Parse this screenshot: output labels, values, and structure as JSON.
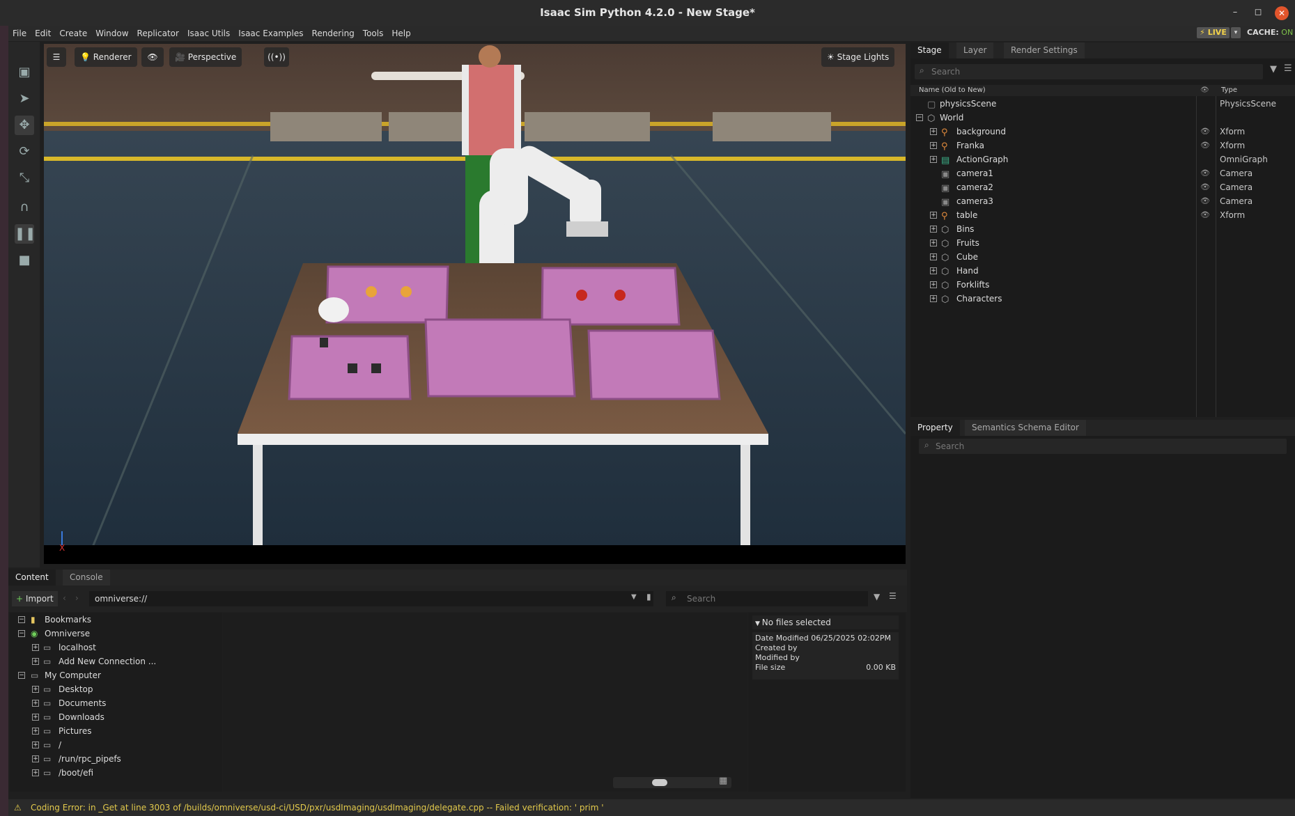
{
  "window": {
    "title": "Isaac Sim Python 4.2.0 - New Stage*",
    "minimize": "–",
    "restore": "◻",
    "close": "✕"
  },
  "menu": [
    "File",
    "Edit",
    "Create",
    "Window",
    "Replicator",
    "Isaac Utils",
    "Isaac Examples",
    "Rendering",
    "Tools",
    "Help"
  ],
  "live": {
    "label": "⚡ LIVE",
    "dropdown": "▾",
    "cache_label": "CACHE:",
    "cache_state": "ON"
  },
  "viewport_bar": {
    "renderer": "Renderer",
    "camera": "Perspective",
    "lights": "Stage Lights"
  },
  "stage_tabs": [
    "Stage",
    "Layer",
    "Render Settings"
  ],
  "stage": {
    "search_placeholder": "Search",
    "col_name": "Name (Old to New)",
    "col_type": "Type",
    "rows": [
      {
        "name": "physicsScene",
        "type": "PhysicsScene"
      },
      {
        "name": "World",
        "type": ""
      },
      {
        "name": "background",
        "type": "Xform"
      },
      {
        "name": "Franka",
        "type": "Xform"
      },
      {
        "name": "ActionGraph",
        "type": "OmniGraph"
      },
      {
        "name": "camera1",
        "type": "Camera"
      },
      {
        "name": "camera2",
        "type": "Camera"
      },
      {
        "name": "camera3",
        "type": "Camera"
      },
      {
        "name": "table",
        "type": "Xform"
      },
      {
        "name": "Bins",
        "type": ""
      },
      {
        "name": "Fruits",
        "type": ""
      },
      {
        "name": "Cube",
        "type": ""
      },
      {
        "name": "Hand",
        "type": ""
      },
      {
        "name": "Forklifts",
        "type": ""
      },
      {
        "name": "Characters",
        "type": ""
      }
    ]
  },
  "property_tabs": [
    "Property",
    "Semantics Schema Editor"
  ],
  "property": {
    "search_placeholder": "Search"
  },
  "content_tabs": [
    "Content",
    "Console"
  ],
  "content": {
    "import_label": "Import",
    "path": "omniverse://",
    "search_placeholder": "Search",
    "tree": [
      {
        "label": "Bookmarks"
      },
      {
        "label": "Omniverse"
      },
      {
        "label": "localhost"
      },
      {
        "label": "Add New Connection ..."
      },
      {
        "label": "My Computer"
      },
      {
        "label": "Desktop"
      },
      {
        "label": "Documents"
      },
      {
        "label": "Downloads"
      },
      {
        "label": "Pictures"
      },
      {
        "label": "/"
      },
      {
        "label": "/run/rpc_pipefs"
      },
      {
        "label": "/boot/efi"
      }
    ],
    "details": {
      "header": "No files selected",
      "date_modified_label": "Date Modified",
      "date_modified": "06/25/2025 02:02PM",
      "created_by_label": "Created by",
      "modified_by_label": "Modified by",
      "file_size_label": "File size",
      "file_size": "0.00 KB"
    }
  },
  "status": {
    "message": "Coding Error: in _Get at line 3003 of /builds/omniverse/usd-ci/USD/pxr/usdImaging/usdImaging/delegate.cpp -- Failed verification: ' prim '"
  },
  "colors": {
    "accent_orange": "#e2552c",
    "live_yellow": "#f2d24a",
    "cache_green": "#7ec24a",
    "warning": "#e2c94c"
  }
}
